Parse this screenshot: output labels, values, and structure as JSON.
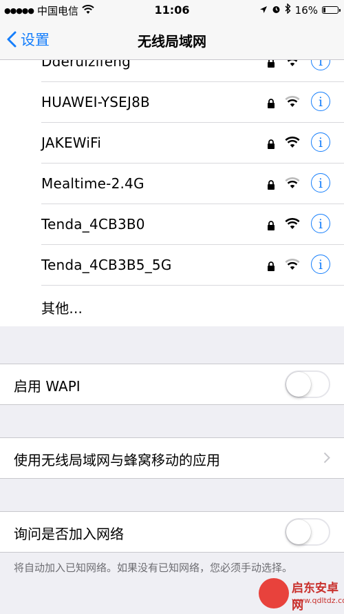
{
  "status_bar": {
    "signal_dots": "●●●●●",
    "carrier": "中国电信",
    "time": "11:06",
    "battery_percent": "16%",
    "battery_level": 0.16
  },
  "nav": {
    "back_label": "设置",
    "title": "无线局域网"
  },
  "networks": [
    {
      "name": "Dderuizifeng",
      "locked": true,
      "signal": "full"
    },
    {
      "name": "HUAWEI-YSEJ8B",
      "locked": true,
      "signal": "medium"
    },
    {
      "name": "JAKEWiFi",
      "locked": true,
      "signal": "full"
    },
    {
      "name": "Mealtime-2.4G",
      "locked": true,
      "signal": "medium"
    },
    {
      "name": "Tenda_4CB3B0",
      "locked": true,
      "signal": "full"
    },
    {
      "name": "Tenda_4CB3B5_5G",
      "locked": true,
      "signal": "medium"
    }
  ],
  "other_label": "其他...",
  "wapi": {
    "label": "启用 WAPI",
    "enabled": false
  },
  "apps_row": {
    "label": "使用无线局域网与蜂窝移动的应用"
  },
  "ask_join": {
    "label": "询问是否加入网络",
    "enabled": false,
    "note": "将自动加入已知网络。如果没有已知网络，您必须手动选择。"
  },
  "watermark": {
    "title": "启东安卓网",
    "url": "www.qdltdz.com"
  },
  "colors": {
    "accent": "#157efb",
    "background": "#efeff4"
  }
}
